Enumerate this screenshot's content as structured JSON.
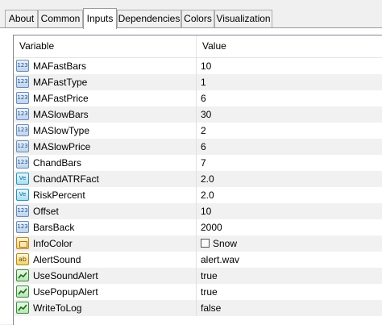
{
  "tabs": [
    "About",
    "Common",
    "Inputs",
    "Dependencies",
    "Colors",
    "Visualization"
  ],
  "active_tab": "Inputs",
  "table": {
    "columns": [
      "Variable",
      "Value"
    ],
    "rows": [
      {
        "name": "MAFastBars",
        "value": "10",
        "type": "int",
        "icon": "int-icon"
      },
      {
        "name": "MAFastType",
        "value": "1",
        "type": "int",
        "icon": "int-icon"
      },
      {
        "name": "MAFastPrice",
        "value": "6",
        "type": "int",
        "icon": "int-icon"
      },
      {
        "name": "MASlowBars",
        "value": "30",
        "type": "int",
        "icon": "int-icon"
      },
      {
        "name": "MASlowType",
        "value": "2",
        "type": "int",
        "icon": "int-icon"
      },
      {
        "name": "MASlowPrice",
        "value": "6",
        "type": "int",
        "icon": "int-icon"
      },
      {
        "name": "ChandBars",
        "value": "7",
        "type": "int",
        "icon": "int-icon"
      },
      {
        "name": "ChandATRFact",
        "value": "2.0",
        "type": "double",
        "icon": "double-icon"
      },
      {
        "name": "RiskPercent",
        "value": "2.0",
        "type": "double",
        "icon": "double-icon"
      },
      {
        "name": "Offset",
        "value": "10",
        "type": "int",
        "icon": "int-icon"
      },
      {
        "name": "BarsBack",
        "value": "2000",
        "type": "int",
        "icon": "int-icon"
      },
      {
        "name": "InfoColor",
        "value": "Snow",
        "type": "color",
        "icon": "color-icon",
        "swatch": "#fffafa"
      },
      {
        "name": "AlertSound",
        "value": "alert.wav",
        "type": "string",
        "icon": "string-icon"
      },
      {
        "name": "UseSoundAlert",
        "value": "true",
        "type": "bool",
        "icon": "bool-icon"
      },
      {
        "name": "UsePopupAlert",
        "value": "true",
        "type": "bool",
        "icon": "bool-icon"
      },
      {
        "name": "WriteToLog",
        "value": "false",
        "type": "bool",
        "icon": "bool-icon"
      }
    ]
  },
  "colors": {
    "grid_border": "#828790",
    "alt_row": "#f1f1f1",
    "tab_border": "#adadad"
  }
}
